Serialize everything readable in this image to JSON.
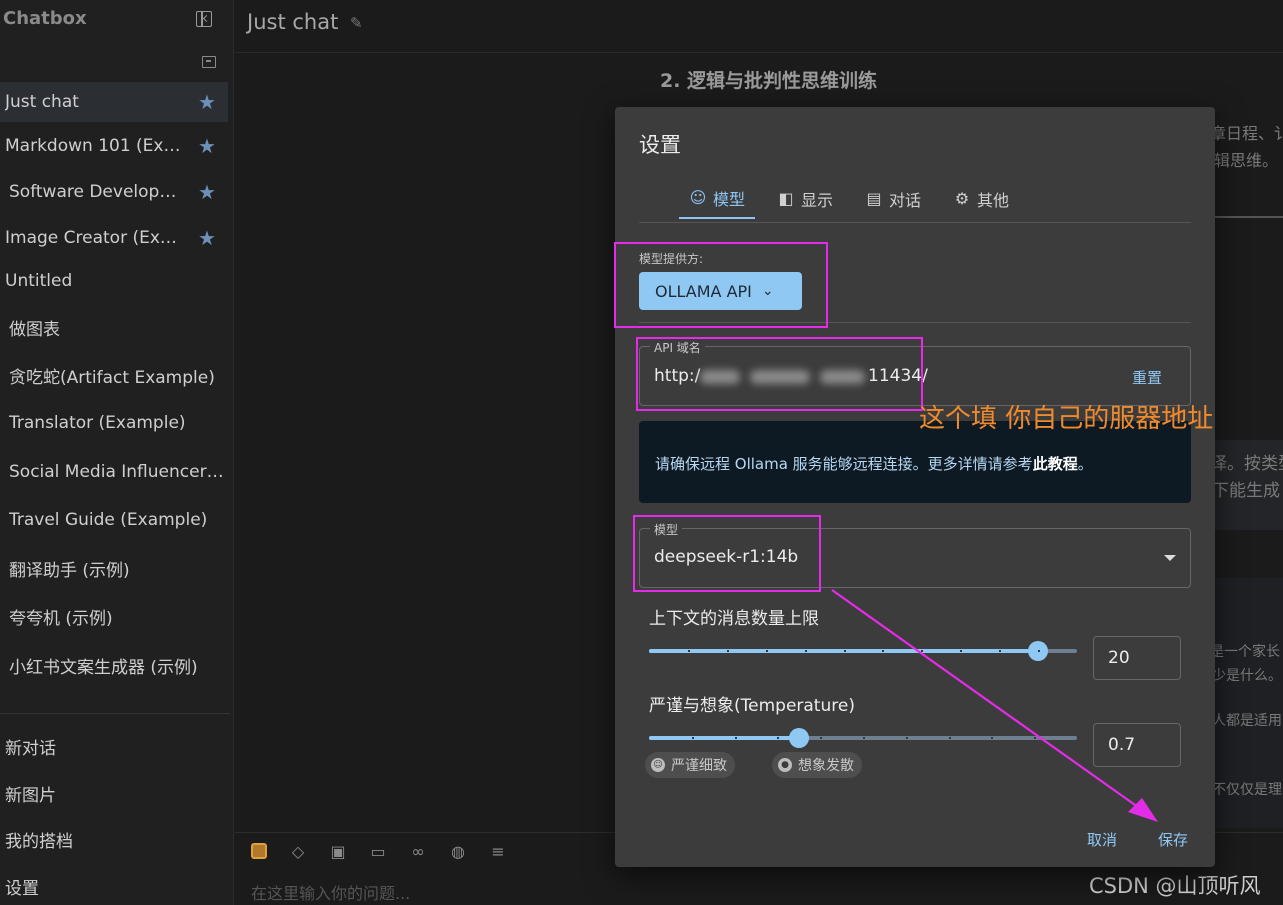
{
  "app": {
    "brand": "Chatbox",
    "chat_title": "Just chat"
  },
  "sidebar": {
    "sessions": [
      {
        "label": "Just chat",
        "starred": true,
        "active": true
      },
      {
        "label": "Markdown 101 (Exa…",
        "starred": true
      },
      {
        "label": "Software Developer…",
        "starred": true
      },
      {
        "label": "Image Creator (Exa…",
        "starred": true
      },
      {
        "label": "Untitled"
      },
      {
        "label": "做图表"
      },
      {
        "label": "贪吃蛇(Artifact Example)"
      },
      {
        "label": "Translator (Example)"
      },
      {
        "label": "Social Media Influencer …"
      },
      {
        "label": "Travel Guide (Example)"
      },
      {
        "label": "翻译助手 (示例)"
      },
      {
        "label": "夸夸机 (示例)"
      },
      {
        "label": "小红书文案生成器 (示例)"
      }
    ],
    "bottom": {
      "new_chat": "新对话",
      "new_image": "新图片",
      "my_copilots": "我的搭档",
      "settings": "设置"
    }
  },
  "background": {
    "heading": "2. 逻辑与批判性思维训练",
    "line1": "章日程、讠",
    "line2": "辑思维。",
    "line3": "译。按类型",
    "line4": "下能生成",
    "line5": "是一个家长",
    "line6": "少是什么。",
    "line7": "人都是适用",
    "line8": "不仅仅是理"
  },
  "composer": {
    "placeholder": "在这里输入你的问题..."
  },
  "watermark": "CSDN @山顶听风",
  "dialog": {
    "title": "设置",
    "tabs": [
      {
        "label": "模型",
        "icon": "robot-icon",
        "active": true
      },
      {
        "label": "显示",
        "icon": "display-icon"
      },
      {
        "label": "对话",
        "icon": "chat-icon"
      },
      {
        "label": "其他",
        "icon": "gear-icon"
      }
    ],
    "provider": {
      "label": "模型提供方:",
      "value": "OLLAMA API"
    },
    "api_host": {
      "label": "API 域名",
      "value_prefix": "http:/",
      "value_suffix": "11434/",
      "reset": "重置"
    },
    "info": {
      "text": "请确保远程 Ollama 服务能够远程连接。更多详情请参考",
      "link": "此教程",
      "end": "。"
    },
    "model": {
      "label": "模型",
      "value": "deepseek-r1:14b"
    },
    "context": {
      "label": "上下文的消息数量上限",
      "value": "20",
      "fraction": 0.91
    },
    "temperature": {
      "label": "严谨与想象(Temperature)",
      "value": "0.7",
      "fraction": 0.35,
      "chip_left": "严谨细致",
      "chip_right": "想象发散"
    },
    "cancel": "取消",
    "save": "保存"
  },
  "annotation": {
    "text": "这个填 你自己的服器地址",
    "color": "#f08a2c",
    "box_color": "#e42ce8"
  }
}
